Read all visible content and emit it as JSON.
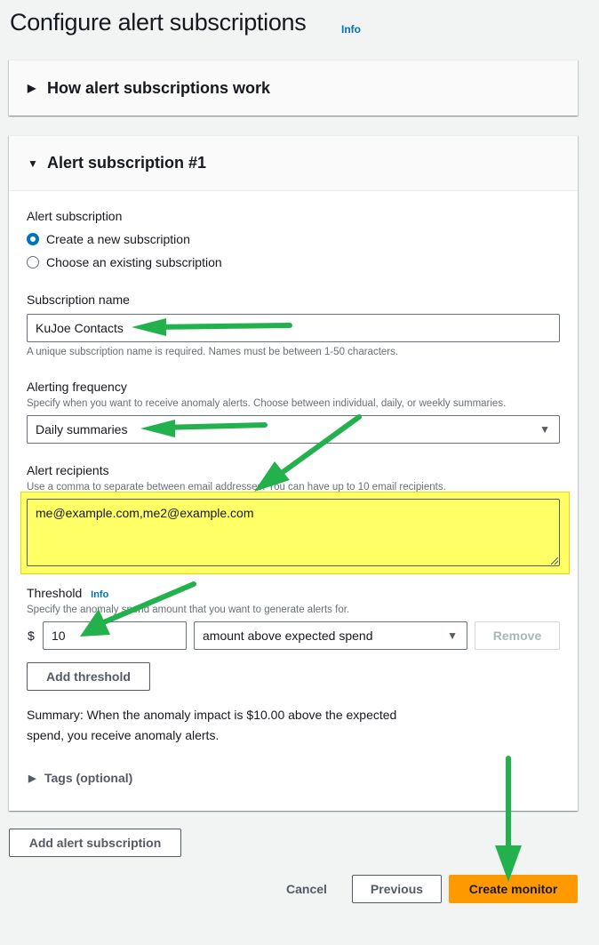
{
  "page": {
    "title": "Configure alert subscriptions",
    "info_label": "Info"
  },
  "how_panel": {
    "title": "How alert subscriptions work",
    "expanded": false
  },
  "subscription": {
    "title": "Alert subscription #1",
    "expanded": true,
    "alert_subscription": {
      "label": "Alert subscription",
      "options": [
        {
          "label": "Create a new subscription",
          "checked": true
        },
        {
          "label": "Choose an existing subscription",
          "checked": false
        }
      ]
    },
    "name": {
      "label": "Subscription name",
      "value": "KuJoe Contacts",
      "hint": "A unique subscription name is required. Names must be between 1-50 characters."
    },
    "frequency": {
      "label": "Alerting frequency",
      "description": "Specify when you want to receive anomaly alerts. Choose between individual, daily, or weekly summaries.",
      "value": "Daily summaries"
    },
    "recipients": {
      "label": "Alert recipients",
      "description": "Use a comma to separate between email addresses. You can have up to 10 email recipients.",
      "value": "me@example.com,me2@example.com",
      "highlight_color": "#ffff66"
    },
    "threshold": {
      "label": "Threshold",
      "info_label": "Info",
      "description": "Specify the anomaly spend amount that you want to generate alerts for.",
      "currency_symbol": "$",
      "value": "10",
      "type": "amount above expected spend",
      "remove_label": "Remove",
      "add_label": "Add threshold"
    },
    "summary": "Summary: When the anomaly impact is $10.00 above the expected spend, you receive anomaly alerts.",
    "tags_label": "Tags (optional)"
  },
  "footer": {
    "add_subscription_label": "Add alert subscription",
    "cancel_label": "Cancel",
    "previous_label": "Previous",
    "create_label": "Create monitor",
    "primary_color": "#ff9900"
  },
  "annotations": {
    "arrow_color": "#22b14c",
    "arrow_count": 5
  }
}
